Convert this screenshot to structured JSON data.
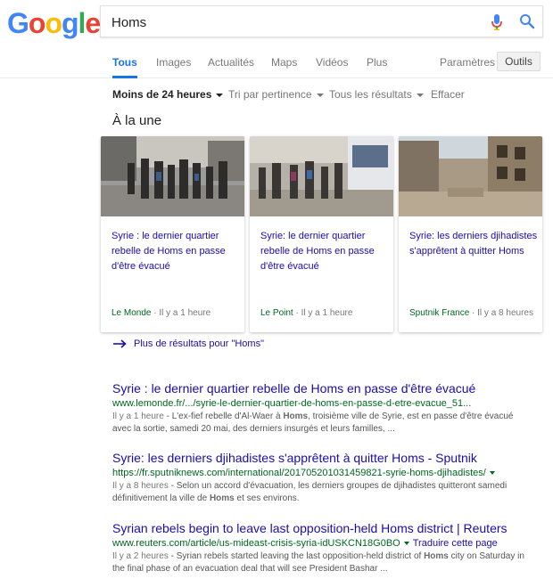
{
  "logo": {
    "letters": [
      "G",
      "o",
      "o",
      "g",
      "l",
      "e"
    ],
    "colors": [
      "#4285F4",
      "#EA4335",
      "#FBBC05",
      "#4285F4",
      "#34A853",
      "#EA4335"
    ]
  },
  "search": {
    "value": "Homs"
  },
  "tabs": [
    {
      "label": "Tous",
      "active": true
    },
    {
      "label": "Images"
    },
    {
      "label": "Actualités"
    },
    {
      "label": "Maps"
    },
    {
      "label": "Vidéos"
    },
    {
      "label": "Plus"
    }
  ],
  "settings_label": "Paramètres",
  "tools_label": "Outils",
  "filters": {
    "time": "Moins de 24 heures",
    "sort": "Tri par pertinence",
    "all": "Tous les résultats",
    "clear": "Effacer"
  },
  "top_stories": {
    "title": "À la une",
    "cards": [
      {
        "title": "Syrie : le dernier quartier rebelle de Homs en passe d'être évacué",
        "source": "Le Monde",
        "time": " · Il y a 1 heure"
      },
      {
        "title": "Syrie: le dernier quartier rebelle de Homs en passe d'être évacué",
        "source": "Le Point",
        "time": " · Il y a 1 heure"
      },
      {
        "title": "Syrie: les derniers djihadistes s'apprêtent à quitter Homs",
        "source": "Sputnik France",
        "time": " · Il y a 8 heures"
      }
    ],
    "more": "Plus de résultats pour \"Homs\""
  },
  "results": [
    {
      "title": "Syrie : le dernier quartier rebelle de Homs en passe d'être évacué",
      "url": "www.lemonde.fr/.../syrie-le-dernier-quartier-de-homs-en-passe-d-etre-evacue_51...",
      "date": "Il y a 1 heure",
      "snippet_before": " - L'ex-fief rebelle d'Al-Waer à ",
      "snippet_bold": "Homs",
      "snippet_after": ", troisième ville de Syrie, est en passe d'être évacué avec la sortie, samedi 20 mai, des derniers insurgés et leurs familles, ..."
    },
    {
      "title": "Syrie: les derniers djihadistes s'apprêtent à quitter Homs - Sputnik",
      "url": "https://fr.sputniknews.com/international/201705201031459821-syrie-homs-djihadistes/",
      "date": "Il y a 8 heures",
      "snippet_before": " - Selon un accord d'évacuation, les derniers groupes de djihadistes quitteront samedi définitivement la ville de ",
      "snippet_bold": "Homs",
      "snippet_after": " et ses environs."
    },
    {
      "title": "Syrian rebels begin to leave last opposition-held Homs district | Reuters",
      "url": "www.reuters.com/article/us-mideast-crisis-syria-idUSKCN18G0BO",
      "translate": "Traduire cette page",
      "date": "Il y a 2 heures",
      "snippet_before": " - Syrian rebels started leaving the last opposition-held district of ",
      "snippet_bold": "Homs",
      "snippet_after": " city on Saturday in the final phase of an evacuation deal that will see President Bashar ..."
    }
  ]
}
